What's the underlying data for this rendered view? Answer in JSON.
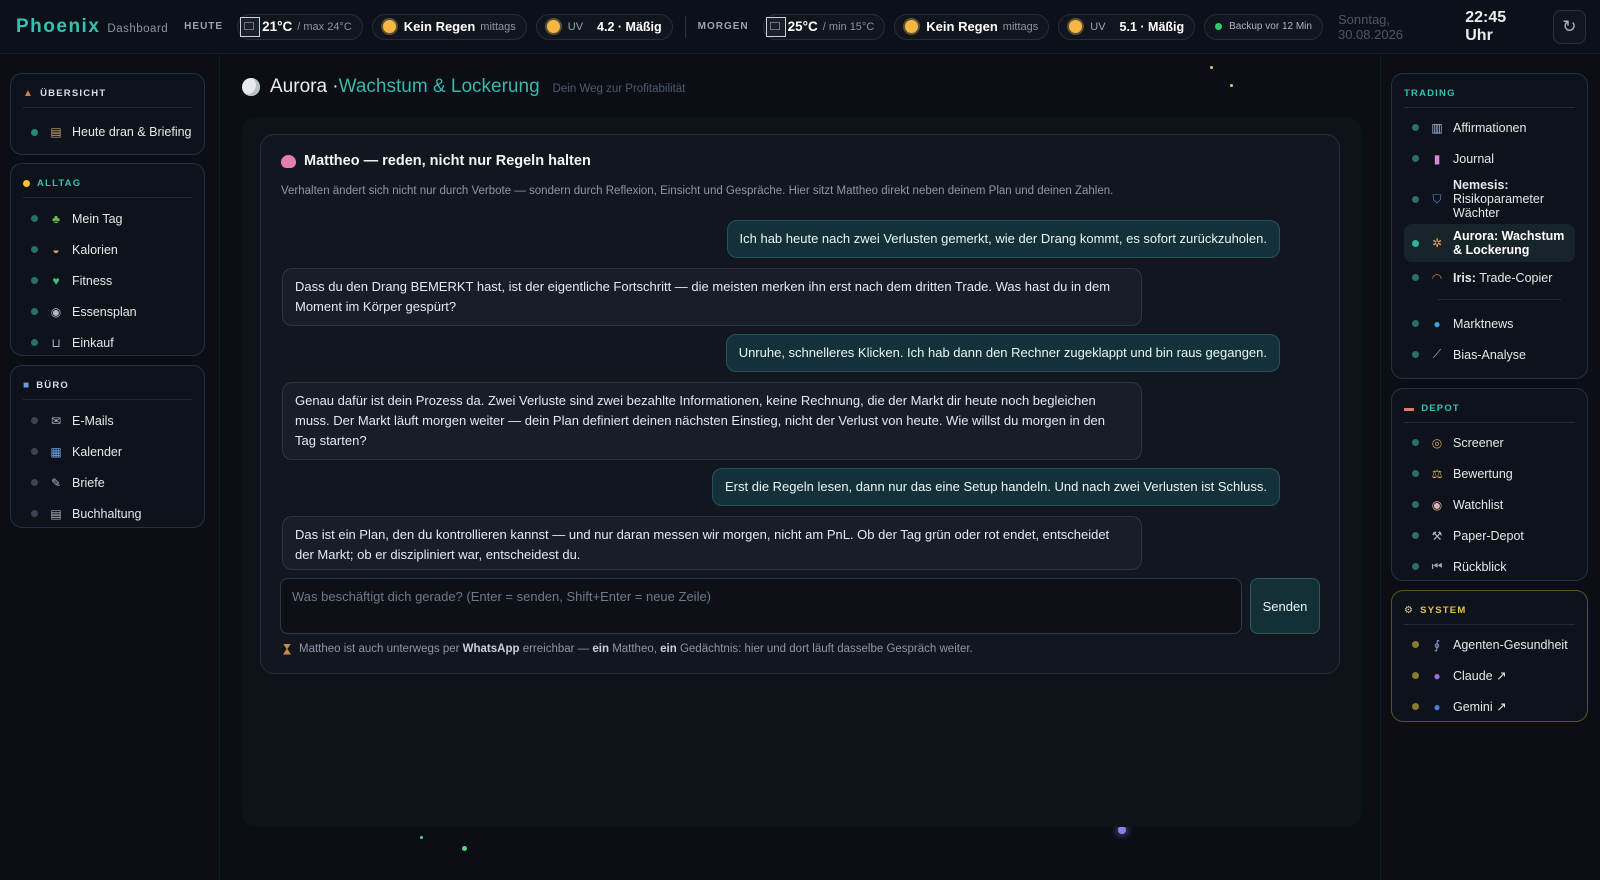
{
  "brand": {
    "name": "Phoenix",
    "sub": "Dashboard"
  },
  "weather": {
    "today": {
      "label": "HEUTE",
      "temp": "21°C",
      "temp_sub": "/ max 24°C",
      "rain": "Kein Regen",
      "rain_sub": "mittags",
      "uv_label": "UV",
      "uv": "4.2 · Mäßig"
    },
    "tomorrow": {
      "label": "MORGEN",
      "temp": "25°C",
      "temp_sub": "/ min 15°C",
      "rain": "Kein Regen",
      "rain_sub": "mittags",
      "uv_label": "UV",
      "uv": "5.1 · Mäßig"
    }
  },
  "status": {
    "backup": "Backup vor 12 Min",
    "date": "Sonntag, 30.08.2026",
    "time": "22:45 Uhr",
    "refresh_icon": "↻"
  },
  "left": {
    "overview": {
      "title": "ÜBERSICHT",
      "items": [
        {
          "label": "Heute dran & Briefing",
          "icon": "clipboard-icon"
        }
      ]
    },
    "alltag": {
      "title": "ALLTAG",
      "items": [
        {
          "label": "Mein Tag",
          "icon": "seedling-icon"
        },
        {
          "label": "Kalorien",
          "icon": "bowl-icon"
        },
        {
          "label": "Fitness",
          "icon": "heart-icon"
        },
        {
          "label": "Essensplan",
          "icon": "plate-icon"
        },
        {
          "label": "Einkauf",
          "icon": "cart-icon"
        }
      ]
    },
    "buero": {
      "title": "BÜRO",
      "items": [
        {
          "label": "E-Mails",
          "icon": "mail-icon"
        },
        {
          "label": "Kalender",
          "icon": "calendar-icon"
        },
        {
          "label": "Briefe",
          "icon": "letter-icon"
        },
        {
          "label": "Buchhaltung",
          "icon": "ledger-icon"
        }
      ]
    }
  },
  "right": {
    "trading": {
      "title": "TRADING",
      "items": [
        {
          "label": "Affirmationen",
          "icon": "book-icon"
        },
        {
          "label": "Journal",
          "icon": "chart-icon"
        },
        {
          "label_bold": "Nemesis:",
          "label": "Risikoparameter Wächter",
          "icon": "shield-icon"
        },
        {
          "label": "Aurora: Wachstum & Lockerung",
          "icon": "compass-icon"
        },
        {
          "label_bold": "Iris:",
          "label": "Trade-Copier",
          "icon": "rainbow-icon"
        },
        {
          "label": "Marktnews",
          "icon": "globe-icon"
        },
        {
          "label": "Bias-Analyse",
          "icon": "trend-icon"
        }
      ]
    },
    "depot": {
      "title": "DEPOT",
      "items": [
        {
          "label": "Screener",
          "icon": "target-icon"
        },
        {
          "label": "Bewertung",
          "icon": "scale-icon"
        },
        {
          "label": "Watchlist",
          "icon": "eye-icon"
        },
        {
          "label": "Paper-Depot",
          "icon": "hammer-icon"
        },
        {
          "label": "Rückblick",
          "icon": "rewind-icon"
        }
      ]
    },
    "system": {
      "title": "SYSTEM",
      "items": [
        {
          "label": "Agenten-Gesundheit",
          "icon": "stethoscope-icon"
        },
        {
          "label": "Claude ↗",
          "icon": "purple-circle-icon"
        },
        {
          "label": "Gemini ↗",
          "icon": "blue-circle-icon"
        }
      ]
    }
  },
  "page": {
    "title_a": "Aurora · ",
    "title_b": "Wachstum & Lockerung",
    "subtitle": "Dein Weg zur Profitabilität"
  },
  "chat": {
    "title": "Mattheo — reden, nicht nur Regeln halten",
    "description": "Verhalten ändert sich nicht nur durch Verbote — sondern durch Reflexion, Einsicht und Gespräche. Hier sitzt Mattheo direkt neben deinem Plan und deinen Zahlen.",
    "messages": [
      {
        "role": "user",
        "text": "Ich hab heute nach zwei Verlusten gemerkt, wie der Drang kommt, es sofort zurückzuholen."
      },
      {
        "role": "assistant",
        "text": "Dass du den Drang BEMERKT hast, ist der eigentliche Fortschritt — die meisten merken ihn erst nach dem dritten Trade. Was hast du in dem Moment im Körper gespürt?"
      },
      {
        "role": "user",
        "text": "Unruhe, schnelleres Klicken. Ich hab dann den Rechner zugeklappt und bin raus gegangen."
      },
      {
        "role": "assistant",
        "text": "Genau dafür ist dein Prozess da. Zwei Verluste sind zwei bezahlte Informationen, keine Rechnung, die der Markt dir heute noch begleichen muss. Der Markt läuft morgen weiter — dein Plan definiert deinen nächsten Einstieg, nicht der Verlust von heute. Wie willst du morgen in den Tag starten?"
      },
      {
        "role": "user",
        "text": "Erst die Regeln lesen, dann nur das eine Setup handeln. Und nach zwei Verlusten ist Schluss."
      },
      {
        "role": "assistant",
        "text": "Das ist ein Plan, den du kontrollieren kannst — und nur daran messen wir morgen, nicht am PnL. Ob der Tag grün oder rot endet, entscheidet der Markt; ob er diszipliniert war, entscheidest du."
      }
    ],
    "input_placeholder": "Was beschäftigt dich gerade? (Enter = senden, Shift+Enter = neue Zeile)",
    "send_label": "Senden",
    "footer": {
      "t1": "Mattheo ist auch unterwegs per ",
      "b1": "WhatsApp",
      "t2": " erreichbar — ",
      "b2": "ein",
      "t3": " Mattheo, ",
      "b3": "ein",
      "t4": " Gedächtnis: hier und dort läuft dasselbe Gespräch weiter."
    }
  },
  "colors": {
    "accent": "#35c3b0",
    "user_bubble": "#14313a",
    "bot_bubble": "#181d29",
    "system_accent": "#e4c44a"
  }
}
